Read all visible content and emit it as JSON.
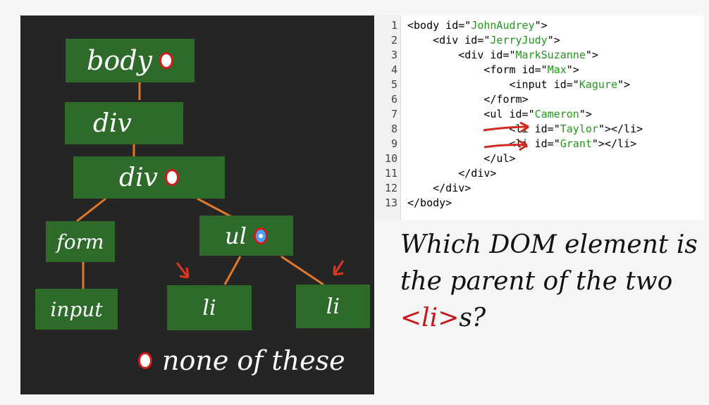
{
  "tree": {
    "body_label": "body",
    "div1_label": "div",
    "div2_label": "div",
    "form_label": "form",
    "ul_label": "ul",
    "input_label": "input",
    "li1_label": "li",
    "li2_label": "li",
    "none_label": "none of these"
  },
  "code": {
    "lines": [
      {
        "n": "1",
        "a": "<body id=\"",
        "s": "JohnAudrey",
        "b": "\">"
      },
      {
        "n": "2",
        "a": "    <div id=\"",
        "s": "JerryJudy",
        "b": "\">"
      },
      {
        "n": "3",
        "a": "        <div id=\"",
        "s": "MarkSuzanne",
        "b": "\">"
      },
      {
        "n": "4",
        "a": "            <form id=\"",
        "s": "Max",
        "b": "\">"
      },
      {
        "n": "5",
        "a": "                <input id=\"",
        "s": "Kagure",
        "b": "\">"
      },
      {
        "n": "6",
        "a": "            </form>",
        "s": "",
        "b": ""
      },
      {
        "n": "7",
        "a": "            <ul id=\"",
        "s": "Cameron",
        "b": "\">"
      },
      {
        "n": "8",
        "a": "                <li id=\"",
        "s": "Taylor",
        "b": "\"></li>"
      },
      {
        "n": "9",
        "a": "                <li id=\"",
        "s": "Grant",
        "b": "\"></li>"
      },
      {
        "n": "10",
        "a": "            </ul>",
        "s": "",
        "b": ""
      },
      {
        "n": "11",
        "a": "        </div>",
        "s": "",
        "b": ""
      },
      {
        "n": "12",
        "a": "    </div>",
        "s": "",
        "b": ""
      },
      {
        "n": "13",
        "a": "</body>",
        "s": "",
        "b": ""
      }
    ]
  },
  "question": {
    "line1": "Which DOM element is",
    "line2": "the parent of the two",
    "tag": "<li>",
    "suffix": "s?"
  },
  "colors": {
    "node_green": "#2e6b2a",
    "radio_red": "#d31b1b",
    "selected_blue": "#4aa3ff",
    "board": "#252525",
    "code_string": "#21981a"
  }
}
